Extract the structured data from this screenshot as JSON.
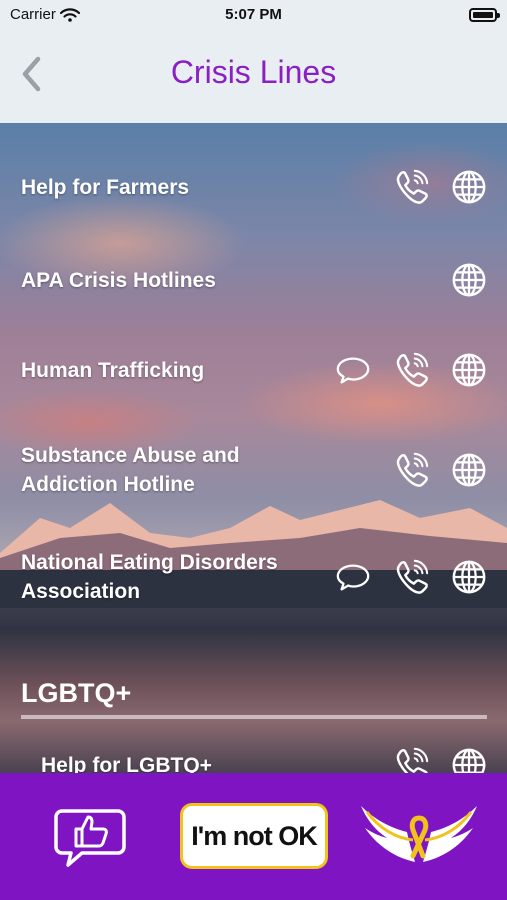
{
  "status": {
    "carrier": "Carrier",
    "time": "5:07 PM"
  },
  "nav": {
    "title": "Crisis Lines",
    "back_icon": "chevron-left-icon"
  },
  "rows": [
    {
      "label": "Help for Farmers",
      "icons": [
        "phone-icon",
        "globe-icon"
      ]
    },
    {
      "label": "APA Crisis Hotlines",
      "icons": [
        "globe-icon"
      ]
    },
    {
      "label": "Human Trafficking",
      "icons": [
        "chat-icon",
        "phone-icon",
        "globe-icon"
      ]
    },
    {
      "label_line1": "Substance Abuse and",
      "label_line2": "Addiction Hotline",
      "icons": [
        "phone-icon",
        "globe-icon"
      ]
    },
    {
      "label_line1": "National Eating Disorders",
      "label_line2": "Association",
      "icons": [
        "chat-icon",
        "phone-icon",
        "globe-icon"
      ]
    }
  ],
  "section": {
    "title": "LGBTQ+",
    "items": [
      {
        "label": "Help for LGBTQ+",
        "icons": [
          "phone-icon",
          "globe-icon"
        ]
      }
    ]
  },
  "tabbar": {
    "like_icon": "thumbs-up-chat-icon",
    "not_ok_label": "I'm not OK",
    "logo_icon": "wings-ribbon-logo"
  },
  "colors": {
    "title_purple": "#8a1fc4",
    "tabbar_purple": "#7f14c2",
    "button_border": "#f1c21b"
  }
}
